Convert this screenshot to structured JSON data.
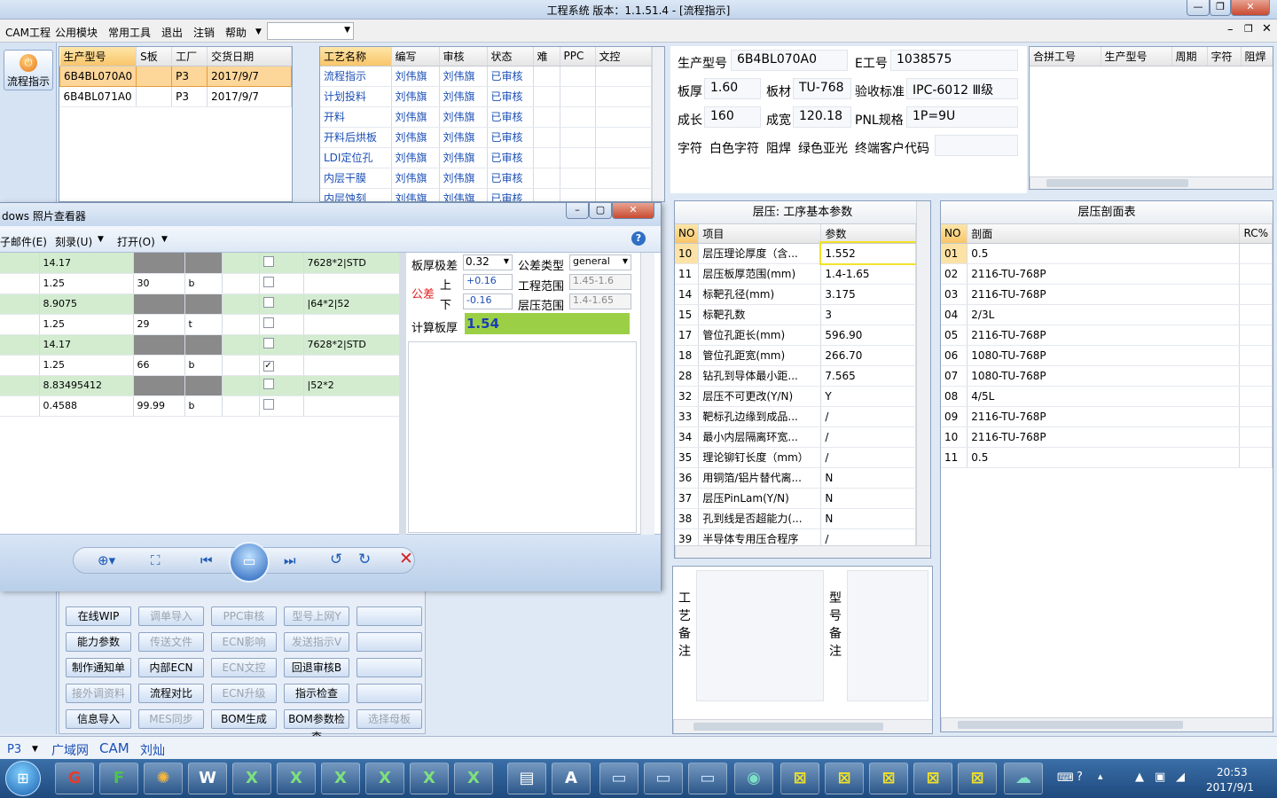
{
  "title": "工程系统    版本：1.1.51.4 - [流程指示]",
  "menu": [
    "CAM工程",
    "公用模块",
    "常用工具",
    "退出",
    "注销",
    "帮助"
  ],
  "flow_btn": "流程指示",
  "orders": {
    "headers": [
      "生产型号",
      "S板",
      "工厂",
      "交货日期"
    ],
    "rows": [
      [
        "6B4BL070A0",
        "",
        "P3",
        "2017/9/7"
      ],
      [
        "6B4BL071A0",
        "",
        "P3",
        "2017/9/7"
      ]
    ]
  },
  "process": {
    "headers": [
      "工艺名称",
      "编写",
      "审核",
      "状态",
      "难",
      "PPC",
      "文控"
    ],
    "rows": [
      [
        "流程指示",
        "刘伟旗",
        "刘伟旗",
        "已审核"
      ],
      [
        "计划投料",
        "刘伟旗",
        "刘伟旗",
        "已审核"
      ],
      [
        "开料",
        "刘伟旗",
        "刘伟旗",
        "已审核"
      ],
      [
        "开料后烘板",
        "刘伟旗",
        "刘伟旗",
        "已审核"
      ],
      [
        "LDI定位孔",
        "刘伟旗",
        "刘伟旗",
        "已审核"
      ],
      [
        "内层干膜",
        "刘伟旗",
        "刘伟旗",
        "已审核"
      ],
      [
        "内层蚀刻",
        "刘伟旗",
        "刘伟旗",
        "已审核"
      ]
    ]
  },
  "info": {
    "l_model": "生产型号",
    "model": "6B4BL070A0",
    "l_e": "E工号",
    "e": "1038575",
    "l_thick": "板厚",
    "thick": "1.60",
    "l_mat": "板材",
    "mat": "TU-768",
    "l_std": "验收标准",
    "std": "IPC-6012 Ⅲ级",
    "l_len": "成长",
    "len": "160",
    "l_wid": "成宽",
    "wid": "120.18",
    "l_pnl": "PNL规格",
    "pnl": "1P=9U",
    "l_char": "字符",
    "char": "白色字符",
    "l_mask": "阻焊",
    "mask": "绿色亚光",
    "l_cust": "终端客户代码",
    "cust": ""
  },
  "merge": {
    "headers": [
      "合拼工号",
      "生产型号",
      "周期",
      "字符",
      "阻焊"
    ]
  },
  "lamination": {
    "title": "层压: 工序基本参数",
    "headers": [
      "NO",
      "项目",
      "参数"
    ],
    "rows": [
      [
        "10",
        "层压理论厚度（含...",
        "1.552"
      ],
      [
        "11",
        "层压板厚范围(mm)",
        "1.4-1.65"
      ],
      [
        "14",
        "标靶孔径(mm)",
        "3.175"
      ],
      [
        "15",
        "标靶孔数",
        "3"
      ],
      [
        "17",
        "管位孔距长(mm)",
        "596.90"
      ],
      [
        "18",
        "管位孔距宽(mm)",
        "266.70"
      ],
      [
        "28",
        "钻孔到导体最小距...",
        "7.565"
      ],
      [
        "32",
        "层压不可更改(Y/N)",
        "Y"
      ],
      [
        "33",
        "靶标孔边缘到成品...",
        "/"
      ],
      [
        "34",
        "最小内层隔离环宽...",
        "/"
      ],
      [
        "35",
        "理论铆钉长度（mm）",
        "/"
      ],
      [
        "36",
        "用铜箔/铝片替代离...",
        "N"
      ],
      [
        "37",
        "层压PinLam(Y/N)",
        "N"
      ],
      [
        "38",
        "孔到线是否超能力(...",
        "N"
      ],
      [
        "39",
        "半导体专用压合程序",
        "/"
      ]
    ]
  },
  "section": {
    "title": "层压剖面表",
    "headers": [
      "NO",
      "剖面",
      "RC%"
    ],
    "rows": [
      [
        "01",
        "0.5"
      ],
      [
        "02",
        "2116-TU-768P"
      ],
      [
        "03",
        "2116-TU-768P"
      ],
      [
        "04",
        "2/3L"
      ],
      [
        "05",
        "2116-TU-768P"
      ],
      [
        "06",
        "1080-TU-768P"
      ],
      [
        "07",
        "1080-TU-768P"
      ],
      [
        "08",
        "4/5L"
      ],
      [
        "09",
        "2116-TU-768P"
      ],
      [
        "10",
        "2116-TU-768P"
      ],
      [
        "11",
        "0.5"
      ]
    ]
  },
  "notes": {
    "craft": "工艺备注",
    "model": "型号备注"
  },
  "photo": {
    "title": "dows 照片查看器",
    "menu": [
      "子邮件(E)",
      "刻录(U)",
      "打开(O)"
    ],
    "rows": [
      [
        "14.17",
        "",
        "",
        "",
        "",
        "7628*2|STD"
      ],
      [
        "1.25",
        "30",
        "b",
        "",
        "",
        ""
      ],
      [
        "8.9075",
        "",
        "",
        "",
        "",
        "|64*2|52"
      ],
      [
        "1.25",
        "29",
        "t",
        "",
        "",
        ""
      ],
      [
        "14.17",
        "",
        "",
        "",
        "",
        "7628*2|STD"
      ],
      [
        "1.25",
        "66",
        "b",
        "",
        "",
        ""
      ],
      [
        "8.83495412",
        "",
        "",
        "",
        "",
        "|52*2"
      ],
      [
        "0.4588",
        "99.99",
        "b",
        "",
        "",
        ""
      ]
    ],
    "l_tol": "板厚极差",
    "tol": "0.32",
    "l_type": "公差类型",
    "type": "general",
    "l_gong": "公差",
    "l_up": "上",
    "up": "+0.16",
    "l_down": "下",
    "down": "-0.16",
    "l_eng": "工程范围",
    "eng": "1.45-1.6",
    "l_lam": "层压范围",
    "lam": "1.4-1.65",
    "l_calc": "计算板厚",
    "calc": "1.54"
  },
  "buttons": [
    [
      "在线WIP",
      "调单导入",
      "PPC审核",
      "型号上网Y",
      ""
    ],
    [
      "能力参数",
      "传送文件",
      "ECN影响",
      "发送指示V",
      ""
    ],
    [
      "制作通知单",
      "内部ECN",
      "ECN文控",
      "回退审核B",
      ""
    ],
    [
      "接外调资料",
      "流程对比",
      "ECN升级",
      "指示检查",
      ""
    ],
    [
      "信息导入",
      "MES同步",
      "BOM生成",
      "BOM参数检查",
      "选择母板"
    ]
  ],
  "status": {
    "p3": "P3",
    "net": "广域网",
    "cam": "CAM",
    "user": "刘灿"
  },
  "clock": {
    "time": "20:53",
    "date": "2017/9/1"
  }
}
